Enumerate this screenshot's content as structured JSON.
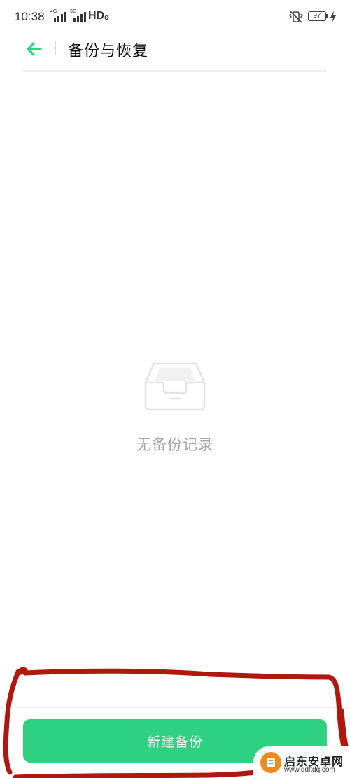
{
  "status_bar": {
    "time": "10:38",
    "signal_1_tag": "4G",
    "signal_2_tag": "3G",
    "network_label": "HDₒ",
    "battery_level": "97",
    "icons": [
      "signal-icon",
      "signal-icon",
      "vibrate-icon",
      "battery-icon",
      "charging-bolt-icon"
    ]
  },
  "header": {
    "back_icon": "back-arrow-icon",
    "title": "备份与恢复"
  },
  "empty_state": {
    "icon": "empty-inbox-icon",
    "message": "无备份记录"
  },
  "footer": {
    "new_backup_label": "新建备份"
  },
  "watermark": {
    "name": "启东安卓网",
    "url": "www.qdltdq.com"
  },
  "colors": {
    "accent": "#2ed17f",
    "annotation": "#b0180f",
    "empty_text": "#a6a6a6"
  }
}
